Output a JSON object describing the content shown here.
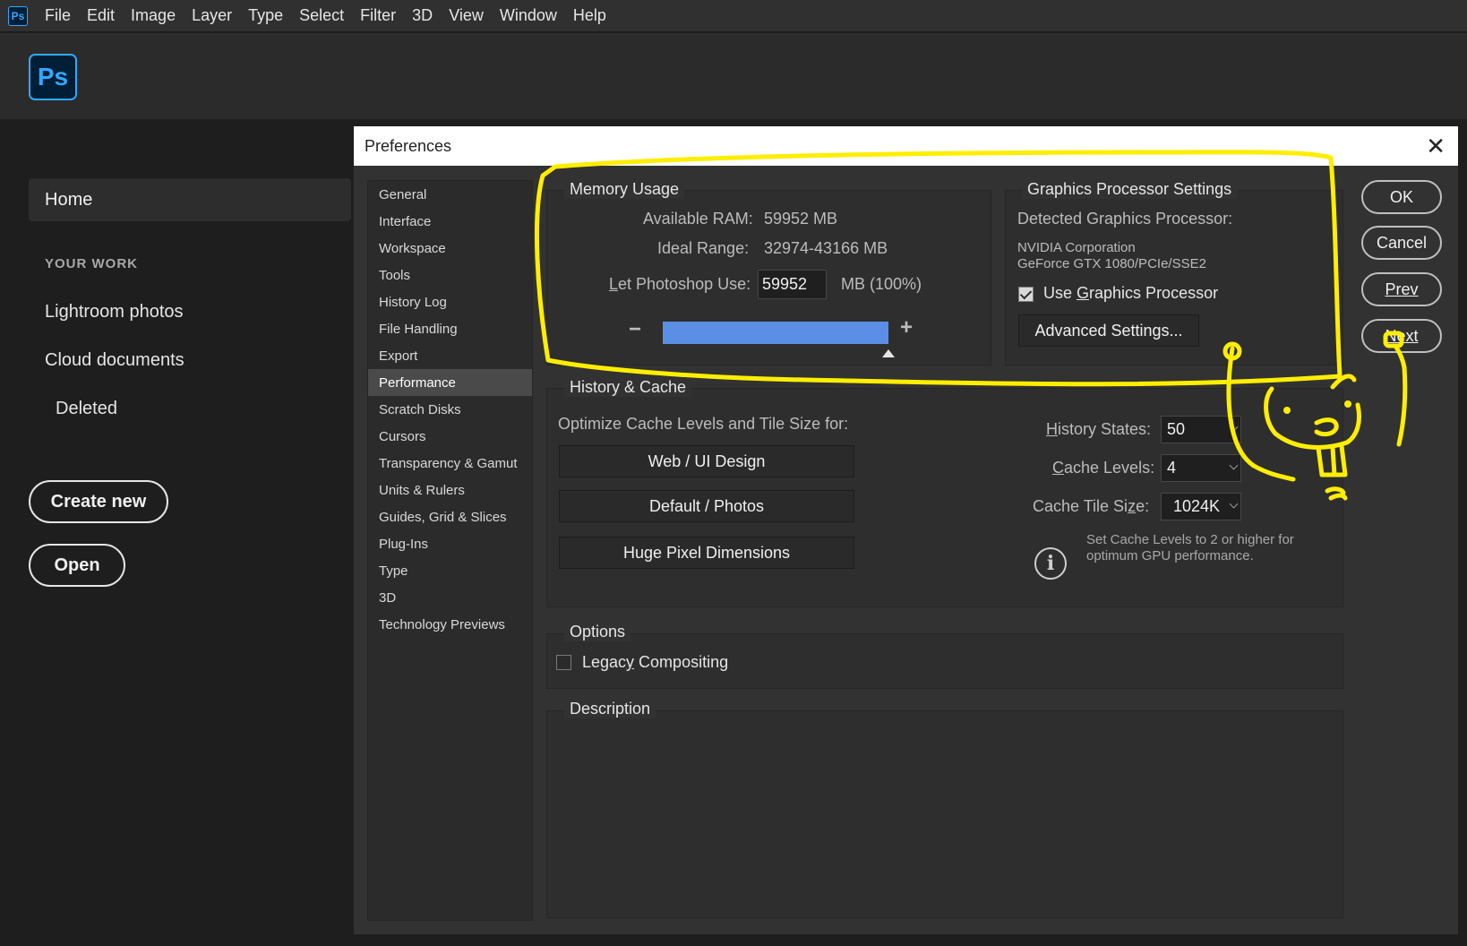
{
  "app": {
    "icon_label": "Ps",
    "menu": [
      "File",
      "Edit",
      "Image",
      "Layer",
      "Type",
      "Select",
      "Filter",
      "3D",
      "View",
      "Window",
      "Help"
    ]
  },
  "home": {
    "logo_label": "Ps",
    "home_label": "Home",
    "your_work": "YOUR WORK",
    "links": [
      "Lightroom photos",
      "Cloud documents",
      "Deleted"
    ],
    "create_new": "Create new",
    "open": "Open"
  },
  "dialog": {
    "title": "Preferences",
    "close_icon": "close-icon",
    "nav": [
      "General",
      "Interface",
      "Workspace",
      "Tools",
      "History Log",
      "File Handling",
      "Export",
      "Performance",
      "Scratch Disks",
      "Cursors",
      "Transparency & Gamut",
      "Units & Rulers",
      "Guides, Grid & Slices",
      "Plug-Ins",
      "Type",
      "3D",
      "Technology Previews"
    ],
    "active_nav": "Performance",
    "memory": {
      "title": "Memory Usage",
      "available_label": "Available RAM:",
      "available_value": "59952 MB",
      "ideal_label": "Ideal Range:",
      "ideal_value": "32974-43166 MB",
      "use_label_first": "L",
      "use_label_rest": "et Photoshop Use:",
      "use_value": "59952",
      "use_unit": "MB (100%)",
      "slider_fraction": 1.0,
      "minus": "−",
      "plus": "+"
    },
    "gpu": {
      "title": "Graphics Processor Settings",
      "detected_label": "Detected Graphics Processor:",
      "vendor": "NVIDIA Corporation",
      "model": "GeForce GTX 1080/PCIe/SSE2",
      "use_gpu_checked": true,
      "use_gpu_pre": "Use ",
      "use_gpu_u": "G",
      "use_gpu_post": "raphics Processor",
      "advanced": "Advanced Settings..."
    },
    "history": {
      "title": "History & Cache",
      "optimize_label": "Optimize Cache Levels and Tile Size for:",
      "buttons": [
        "Web / UI Design",
        "Default / Photos",
        "Huge Pixel Dimensions"
      ],
      "history_states_u": "H",
      "history_states_rest": "istory States:",
      "history_states_value": "50",
      "cache_levels_u": "C",
      "cache_levels_rest": "ache Levels:",
      "cache_levels_value": "4",
      "cache_tile_pre": "Cache Tile Si",
      "cache_tile_u": "z",
      "cache_tile_post": "e:",
      "cache_tile_value": "1024K",
      "info_line1": "Set Cache Levels to 2 or higher for",
      "info_line2": "optimum GPU performance.",
      "info_icon": "info-icon"
    },
    "options": {
      "title": "Options",
      "legacy_pre": "Legac",
      "legacy_u": "y",
      "legacy_post": " Compositing",
      "legacy_checked": false
    },
    "description": {
      "title": "Description"
    },
    "buttons": {
      "ok": "OK",
      "cancel": "Cancel",
      "prev": "Prev",
      "next": "Next"
    }
  },
  "colors": {
    "annotation": "#ffee00",
    "slider_fill": "#5b8fe5",
    "ps_blue": "#31a8ff"
  }
}
